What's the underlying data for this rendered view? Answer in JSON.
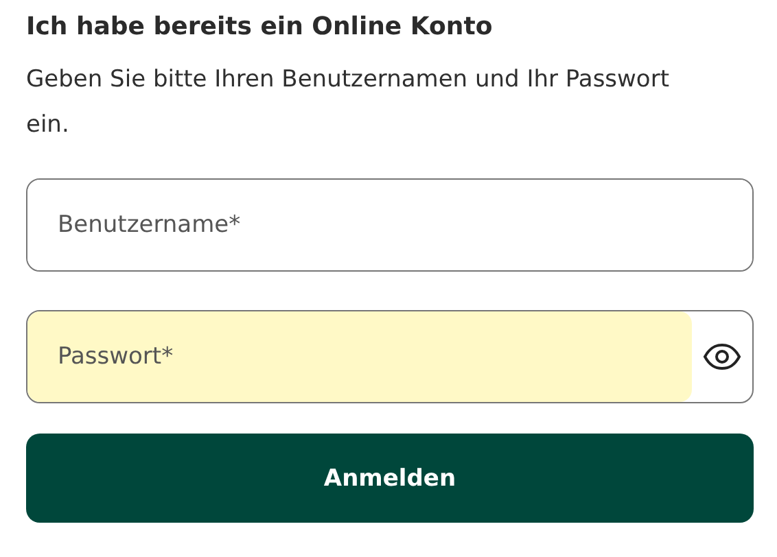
{
  "heading": "Ich habe bereits ein Online Konto",
  "intro": "Geben Sie bitte Ihren Benutzernamen und Ihr Passwort ein.",
  "fields": [
    {
      "kind": "text",
      "placeholder": "Benutzername*",
      "autofilled": false
    },
    {
      "kind": "password",
      "placeholder": "Passwort*",
      "autofilled": true
    }
  ],
  "submit": "Anmelden"
}
